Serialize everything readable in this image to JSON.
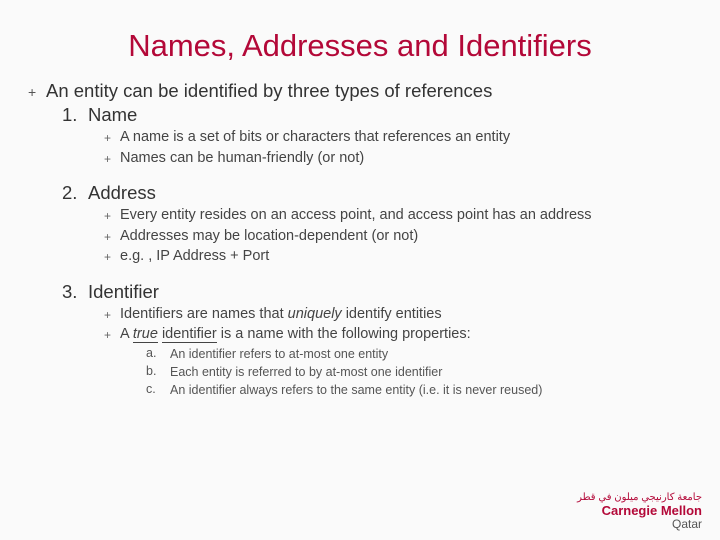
{
  "title": "Names, Addresses and Identifiers",
  "intro": "An entity can be identified by three types of references",
  "sections": [
    {
      "num": "1.",
      "heading": "Name",
      "points": [
        "A name is a set of bits or characters that references an entity",
        "Names can be human-friendly (or not)"
      ]
    },
    {
      "num": "2.",
      "heading": "Address",
      "points": [
        "Every entity resides on an access point, and access point has an address",
        "Addresses may be location-dependent (or not)",
        "e.g. , IP Address + Port"
      ]
    },
    {
      "num": "3.",
      "heading": "Identifier",
      "points": [
        "Identifiers are names that <em>uniquely</em> identify entities",
        "A <em><span class=\"underlined\">true</span></em> <span class=\"underlined\">identifier</span> is a name with the following properties:"
      ],
      "abc": [
        {
          "lbl": "a.",
          "txt": "An identifier refers to at-most one entity"
        },
        {
          "lbl": "b.",
          "txt": "Each entity is referred to by at-most one identifier"
        },
        {
          "lbl": "c.",
          "txt": "An identifier always refers to the same entity (i.e. it is never reused)"
        }
      ]
    }
  ],
  "logo": {
    "arabic": "جامعة كارنيجي ميلون في قطر",
    "line1": "Carnegie Mellon",
    "qatar": "Qatar"
  }
}
